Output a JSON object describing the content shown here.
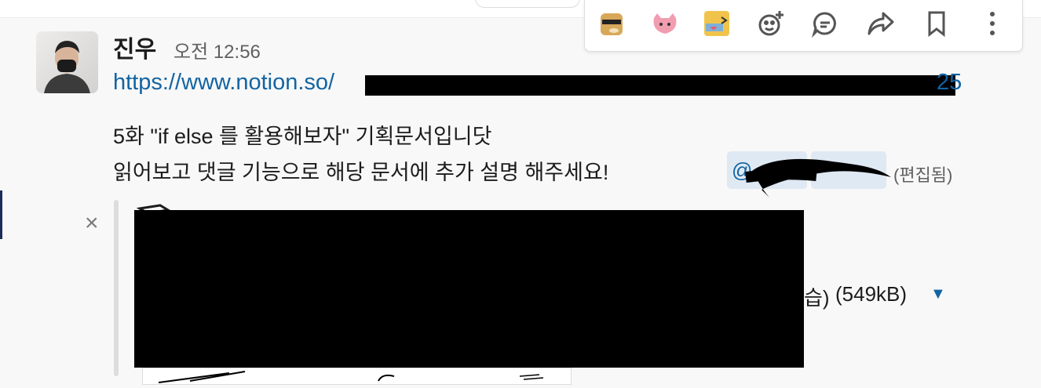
{
  "message": {
    "author": "진우",
    "time": "오전 12:56",
    "link_start": "https://www.notion.so/",
    "link_end": "25",
    "line1": "5화 \"if else 를 활용해보자\" 기획문서입니닷",
    "line2": "읽어보고 댓글 기능으로 해당 문서에 추가 설명 해주세요!",
    "mentions": [
      {
        "text": "@"
      },
      {
        "text": ""
      }
    ],
    "edited": "(편집됨)"
  },
  "attachment": {
    "title": "",
    "name_tail": "습)",
    "size": "(549kB)"
  },
  "toolbar": {
    "icons": [
      "emoji-doge",
      "emoji-pink-cat",
      "emoji-cat-tongue",
      "add-reaction",
      "reply-in-thread",
      "share",
      "bookmark",
      "more-actions"
    ]
  },
  "colors": {
    "link": "#1264a3",
    "mention_bg": "#dfe9f3",
    "text": "#1d1c1d",
    "muted": "#616061"
  }
}
